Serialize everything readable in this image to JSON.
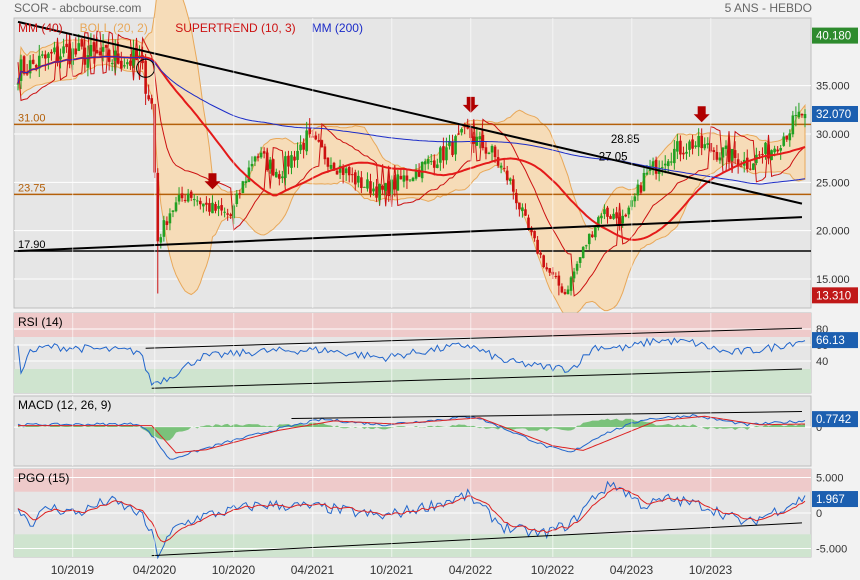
{
  "header": {
    "left": "SCOR - abcbourse.com",
    "right": "5 ANS - HEBDO"
  },
  "chart_data": {
    "type": "candlestick",
    "x_ticks": [
      "10/2019",
      "04/2020",
      "10/2020",
      "04/2021",
      "10/2021",
      "04/2022",
      "10/2022",
      "04/2023",
      "10/2023"
    ],
    "colors": {
      "up": "#22a022",
      "down": "#cc1111",
      "mm40": "#e41a1a",
      "mm200": "#1c2cc8",
      "supertrend": "#cc1111",
      "boll_fill": "#f6dcb8",
      "boll_line": "#e8a85a",
      "rsi": "#2266cc",
      "macd": "#2266cc",
      "macd_signal": "#dd2222",
      "macd_hist": "#66bb66",
      "pgo": "#2266cc",
      "pgo_signal": "#dd2222",
      "zone_high": "#eecaca",
      "zone_low": "#cfe4cf"
    },
    "price_panel": {
      "legend": [
        {
          "label": "MM (40)",
          "color": "#cc1111"
        },
        {
          "label": "BOLL (20, 2)",
          "color": "#e8a85a"
        },
        {
          "label": "SUPERTREND (10, 3)",
          "color": "#cc1111"
        },
        {
          "label": "MM (200)",
          "color": "#1c2cc8"
        }
      ],
      "ylim": [
        12,
        42
      ],
      "y_ticks": [
        "35.000",
        "30.000",
        "25.000",
        "20.000",
        "15.000"
      ],
      "y_tick_values": [
        35,
        30,
        25,
        20,
        15
      ],
      "tags": [
        {
          "label": "40.180",
          "value": 40.18,
          "color": "#2e8b2e"
        },
        {
          "label": "32.070",
          "value": 32.07,
          "color": "#1c5fb0"
        },
        {
          "label": "13.310",
          "value": 13.31,
          "color": "#c01818"
        }
      ],
      "h_levels": [
        {
          "label": "31.00",
          "value": 31.0,
          "color": "#b4600a"
        },
        {
          "label": "23.75",
          "value": 23.75,
          "color": "#b4600a"
        },
        {
          "label": "17.90",
          "value": 17.9,
          "color": "#000000"
        }
      ],
      "annotations": [
        {
          "label": "28.85",
          "x": 205,
          "value": 28.85
        },
        {
          "label": "27.05",
          "x": 201,
          "value": 27.05
        }
      ],
      "arrows_x": [
        64,
        149,
        225
      ],
      "trend_lines": [
        {
          "x": [
            0,
            258
          ],
          "y": [
            41.6,
            22.8
          ]
        },
        {
          "x": [
            0,
            258
          ],
          "y": [
            17.9,
            21.4
          ]
        }
      ],
      "anchors": [
        {
          "x": 0,
          "close": 36.5
        },
        {
          "x": 15,
          "close": 38.5
        },
        {
          "x": 30,
          "close": 37.8
        },
        {
          "x": 40,
          "close": 37.5
        },
        {
          "x": 44,
          "close": 33
        },
        {
          "x": 46,
          "close": 19
        },
        {
          "x": 50,
          "close": 22
        },
        {
          "x": 56,
          "close": 24
        },
        {
          "x": 62,
          "close": 22.5
        },
        {
          "x": 70,
          "close": 21.5
        },
        {
          "x": 78,
          "close": 28
        },
        {
          "x": 86,
          "close": 26
        },
        {
          "x": 95,
          "close": 29.5
        },
        {
          "x": 104,
          "close": 27
        },
        {
          "x": 112,
          "close": 25
        },
        {
          "x": 120,
          "close": 24
        },
        {
          "x": 130,
          "close": 26
        },
        {
          "x": 140,
          "close": 28
        },
        {
          "x": 148,
          "close": 30
        },
        {
          "x": 156,
          "close": 28
        },
        {
          "x": 162,
          "close": 25
        },
        {
          "x": 168,
          "close": 20
        },
        {
          "x": 174,
          "close": 16
        },
        {
          "x": 180,
          "close": 13.5
        },
        {
          "x": 186,
          "close": 18
        },
        {
          "x": 192,
          "close": 22
        },
        {
          "x": 200,
          "close": 21
        },
        {
          "x": 206,
          "close": 25.5
        },
        {
          "x": 214,
          "close": 28
        },
        {
          "x": 222,
          "close": 29
        },
        {
          "x": 232,
          "close": 28
        },
        {
          "x": 240,
          "close": 27
        },
        {
          "x": 248,
          "close": 28.5
        },
        {
          "x": 258,
          "close": 32.07
        }
      ]
    },
    "rsi_panel": {
      "legend": "RSI (14)",
      "value_label": "66.13",
      "ylim": [
        0,
        100
      ],
      "y_ticks": [
        "80",
        "60",
        "40"
      ],
      "y_tick_values": [
        80,
        60,
        40
      ],
      "zones": [
        70,
        30
      ],
      "lines": [
        {
          "x": [
            42,
            258
          ],
          "y": [
            56,
            81
          ]
        },
        {
          "x": [
            44,
            258
          ],
          "y": [
            6,
            30
          ]
        }
      ],
      "anchors": [
        {
          "x": 0,
          "v": 60
        },
        {
          "x": 1,
          "v": 20
        },
        {
          "x": 3,
          "v": 50
        },
        {
          "x": 10,
          "v": 58
        },
        {
          "x": 40,
          "v": 52
        },
        {
          "x": 44,
          "v": 12
        },
        {
          "x": 50,
          "v": 20
        },
        {
          "x": 60,
          "v": 45
        },
        {
          "x": 80,
          "v": 52
        },
        {
          "x": 100,
          "v": 54
        },
        {
          "x": 120,
          "v": 44
        },
        {
          "x": 140,
          "v": 56
        },
        {
          "x": 148,
          "v": 60
        },
        {
          "x": 160,
          "v": 40
        },
        {
          "x": 172,
          "v": 33
        },
        {
          "x": 182,
          "v": 30
        },
        {
          "x": 190,
          "v": 58
        },
        {
          "x": 200,
          "v": 56
        },
        {
          "x": 210,
          "v": 66
        },
        {
          "x": 222,
          "v": 63
        },
        {
          "x": 234,
          "v": 50
        },
        {
          "x": 246,
          "v": 55
        },
        {
          "x": 258,
          "v": 66
        }
      ]
    },
    "macd_panel": {
      "legend": "MACD (12, 26, 9)",
      "value_label": "0.7742",
      "ylim": [
        -5,
        4
      ],
      "y_ticks": [
        "0"
      ],
      "y_tick_values": [
        0
      ],
      "lines": [
        {
          "x": [
            90,
            258
          ],
          "y": [
            1.1,
            2.0
          ]
        }
      ],
      "macd_anchors": [
        {
          "x": 0,
          "v": 0.3
        },
        {
          "x": 40,
          "v": 0.4
        },
        {
          "x": 44,
          "v": -1.0
        },
        {
          "x": 50,
          "v": -4.2
        },
        {
          "x": 56,
          "v": -3.4
        },
        {
          "x": 70,
          "v": -1.8
        },
        {
          "x": 86,
          "v": -0.2
        },
        {
          "x": 100,
          "v": 1.0
        },
        {
          "x": 120,
          "v": 0.3
        },
        {
          "x": 140,
          "v": 1.0
        },
        {
          "x": 150,
          "v": 1.4
        },
        {
          "x": 162,
          "v": -0.5
        },
        {
          "x": 174,
          "v": -2.5
        },
        {
          "x": 182,
          "v": -3.3
        },
        {
          "x": 192,
          "v": -1.0
        },
        {
          "x": 206,
          "v": 1.0
        },
        {
          "x": 222,
          "v": 1.5
        },
        {
          "x": 240,
          "v": 0.3
        },
        {
          "x": 258,
          "v": 0.77
        }
      ],
      "signal_anchors": [
        {
          "x": 0,
          "v": 0.2
        },
        {
          "x": 44,
          "v": 0.2
        },
        {
          "x": 52,
          "v": -3.3
        },
        {
          "x": 62,
          "v": -2.9
        },
        {
          "x": 86,
          "v": -0.4
        },
        {
          "x": 104,
          "v": 0.8
        },
        {
          "x": 124,
          "v": 0.4
        },
        {
          "x": 152,
          "v": 1.2
        },
        {
          "x": 176,
          "v": -2.4
        },
        {
          "x": 186,
          "v": -3.0
        },
        {
          "x": 210,
          "v": 0.8
        },
        {
          "x": 226,
          "v": 1.4
        },
        {
          "x": 244,
          "v": 0.3
        },
        {
          "x": 258,
          "v": 0.4
        }
      ]
    },
    "pgo_panel": {
      "legend": "PGO (15)",
      "value_label": "1.967",
      "ylim": [
        -6.2,
        6.2
      ],
      "y_ticks": [
        "5.000",
        "0",
        "-5.000"
      ],
      "y_tick_values": [
        5,
        0,
        -5
      ],
      "zones": [
        3,
        -3
      ],
      "lines": [
        {
          "x": [
            44,
            258
          ],
          "y": [
            -6.0,
            -1.4
          ]
        }
      ],
      "anchors": [
        {
          "x": 0,
          "v": 1.0
        },
        {
          "x": 4,
          "v": -1.5
        },
        {
          "x": 10,
          "v": 0.8
        },
        {
          "x": 20,
          "v": 0.0
        },
        {
          "x": 30,
          "v": 1.8
        },
        {
          "x": 40,
          "v": 0.0
        },
        {
          "x": 44,
          "v": -3.0
        },
        {
          "x": 46,
          "v": -5.8
        },
        {
          "x": 52,
          "v": -2.0
        },
        {
          "x": 60,
          "v": -0.5
        },
        {
          "x": 80,
          "v": 1.2
        },
        {
          "x": 100,
          "v": 0.8
        },
        {
          "x": 120,
          "v": -0.5
        },
        {
          "x": 140,
          "v": 1.5
        },
        {
          "x": 148,
          "v": 2.5
        },
        {
          "x": 160,
          "v": -2.0
        },
        {
          "x": 172,
          "v": -3.0
        },
        {
          "x": 182,
          "v": -1.5
        },
        {
          "x": 190,
          "v": 2.5
        },
        {
          "x": 196,
          "v": 4.2
        },
        {
          "x": 206,
          "v": 1.0
        },
        {
          "x": 214,
          "v": 2.0
        },
        {
          "x": 226,
          "v": 1.0
        },
        {
          "x": 240,
          "v": -1.5
        },
        {
          "x": 258,
          "v": 2.0
        }
      ]
    }
  }
}
